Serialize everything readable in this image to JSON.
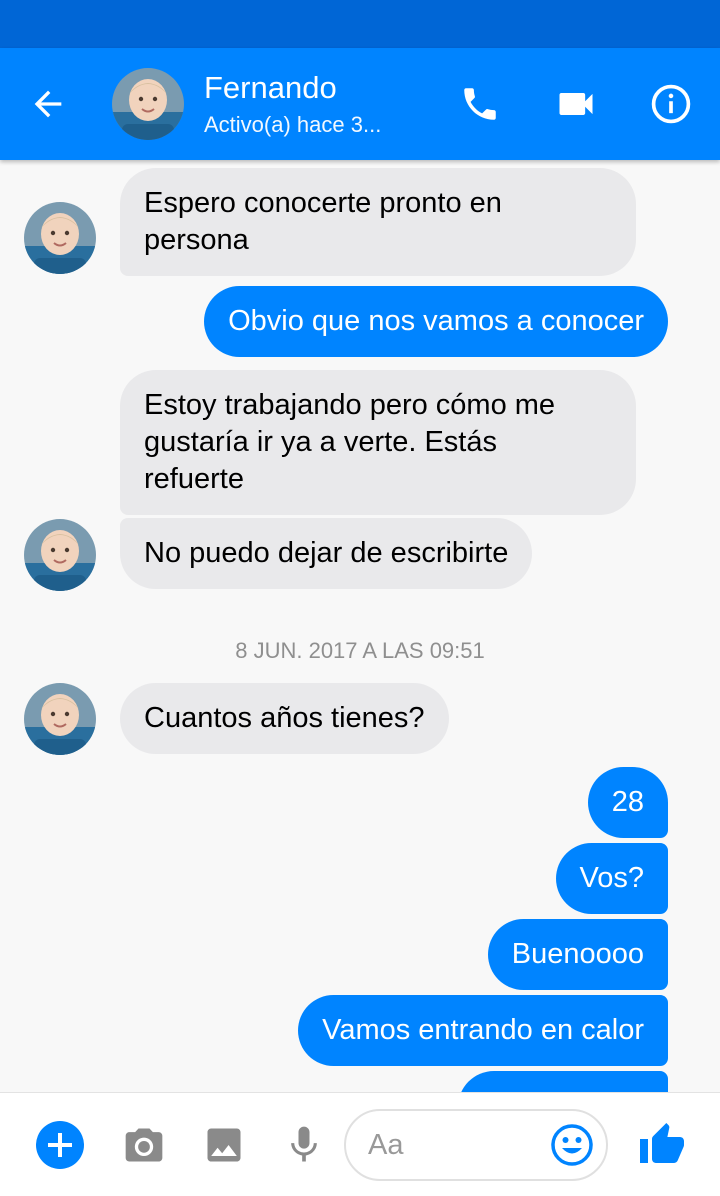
{
  "colors": {
    "accent": "#0084ff",
    "status_bar": "#0066d6",
    "incoming_bubble": "#e9e9eb",
    "timestamp": "#8f8f8f",
    "icon_gray": "#8a8a8a"
  },
  "header": {
    "contact_name": "Fernando",
    "contact_status": "Activo(a) hace 3...",
    "icons": [
      "back-arrow-icon",
      "phone-icon",
      "video-camera-icon",
      "info-icon"
    ]
  },
  "messages": [
    {
      "sender": "Fernando",
      "direction": "in",
      "text": "Espero conocerte pronto en persona",
      "lines": [
        "Espero conocerte pronto en",
        "persona"
      ]
    },
    {
      "sender": "me",
      "direction": "out",
      "text": "Obvio que nos vamos a conocer"
    },
    {
      "sender": "Fernando",
      "direction": "in",
      "text": "Estoy trabajando pero cómo me gustaría ir ya a verte.  Estás refuerte",
      "lines": [
        "Estoy trabajando pero cómo me",
        "gustaría ir ya a verte.  Estás",
        "refuerte"
      ]
    },
    {
      "sender": "Fernando",
      "direction": "in",
      "text": "No puedo dejar de escribirte"
    },
    {
      "type": "timestamp",
      "text": "8 JUN. 2017 A LAS 09:51"
    },
    {
      "sender": "Fernando",
      "direction": "in",
      "text": "Cuantos años tienes?"
    },
    {
      "sender": "me",
      "direction": "out",
      "text": "28"
    },
    {
      "sender": "me",
      "direction": "out",
      "text": "Vos?"
    },
    {
      "sender": "me",
      "direction": "out",
      "text": "Buenoooo"
    },
    {
      "sender": "me",
      "direction": "out",
      "text": "Vamos entrando en calor"
    }
  ],
  "composer": {
    "placeholder": "Aa",
    "icons": [
      "plus-icon",
      "camera-icon",
      "image-icon",
      "microphone-icon",
      "emoji-icon",
      "thumbs-up-icon"
    ]
  }
}
